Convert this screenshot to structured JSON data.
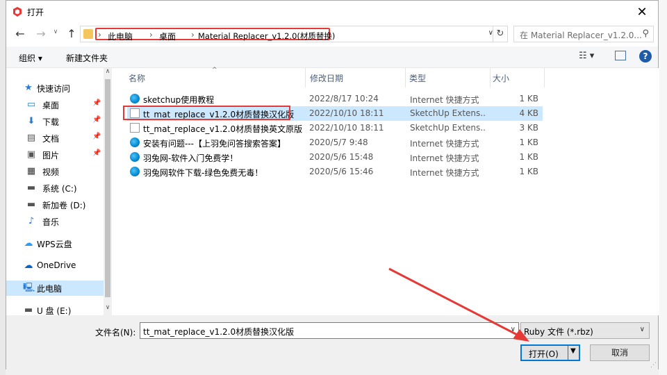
{
  "window": {
    "title": "打开"
  },
  "address": {
    "crumbs": [
      "此电脑",
      "桌面",
      "Material Replacer_v1.2.0(材质替换)"
    ],
    "search_placeholder": "在 Material Replacer_v1.2.0..."
  },
  "toolbar": {
    "organize": "组织 ▾",
    "new_folder": "新建文件夹"
  },
  "nav": {
    "items": [
      {
        "label": "快速访问",
        "icon": "star-icon",
        "pinned": false
      },
      {
        "label": "桌面",
        "icon": "desktop-icon",
        "pinned": true
      },
      {
        "label": "下载",
        "icon": "download-icon",
        "pinned": true
      },
      {
        "label": "文档",
        "icon": "document-icon",
        "pinned": true
      },
      {
        "label": "图片",
        "icon": "picture-icon",
        "pinned": true
      },
      {
        "label": "视频",
        "icon": "video-icon",
        "pinned": false
      },
      {
        "label": "系统 (C:)",
        "icon": "drive-icon",
        "pinned": false
      },
      {
        "label": "新加卷 (D:)",
        "icon": "drive-icon",
        "pinned": false
      },
      {
        "label": "音乐",
        "icon": "music-icon",
        "pinned": false
      },
      {
        "label": "WPS云盘",
        "icon": "cloud-icon",
        "pinned": false
      },
      {
        "label": "OneDrive",
        "icon": "cloud-icon",
        "pinned": false
      },
      {
        "label": "此电脑",
        "icon": "computer-icon",
        "pinned": false
      },
      {
        "label": "U 盘 (E:)",
        "icon": "usb-drive-icon",
        "pinned": false
      }
    ],
    "selected": "此电脑"
  },
  "columns": {
    "name": "名称",
    "date": "修改日期",
    "type": "类型",
    "size": "大小"
  },
  "files": [
    {
      "name": "sketchup使用教程",
      "date": "2022/8/17 10:24",
      "type": "Internet 快捷方式",
      "size": "1 KB",
      "icon": "internet-shortcut-icon"
    },
    {
      "name": "tt_mat_replace_v1.2.0材质替换汉化版",
      "date": "2022/10/10 18:11",
      "type": "SketchUp Extens...",
      "size": "4 KB",
      "icon": "file-icon"
    },
    {
      "name": "tt_mat_replace_v1.2.0材质替换英文原版",
      "date": "2022/10/10 18:11",
      "type": "SketchUp Extens...",
      "size": "3 KB",
      "icon": "file-icon"
    },
    {
      "name": "安装有问题---【上羽免问答搜索答案】",
      "date": "2020/5/7 9:48",
      "type": "Internet 快捷方式",
      "size": "1 KB",
      "icon": "internet-shortcut-icon"
    },
    {
      "name": "羽兔网-软件入门免费学！",
      "date": "2020/5/6 15:48",
      "type": "Internet 快捷方式",
      "size": "1 KB",
      "icon": "internet-shortcut-icon"
    },
    {
      "name": "羽兔网软件下载-绿色免费无毒！",
      "date": "2020/5/6 15:46",
      "type": "Internet 快捷方式",
      "size": "1 KB",
      "icon": "internet-shortcut-icon"
    }
  ],
  "bottom": {
    "filename_label": "文件名(N):",
    "filename_value": "tt_mat_replace_v1.2.0材质替换汉化版",
    "filetype": "Ruby 文件 (*.rbz)",
    "open": "打开(O)",
    "cancel": "取消"
  },
  "colors": {
    "highlight": "#e53935",
    "selection": "#cce8ff",
    "accent": "#0078d7"
  }
}
